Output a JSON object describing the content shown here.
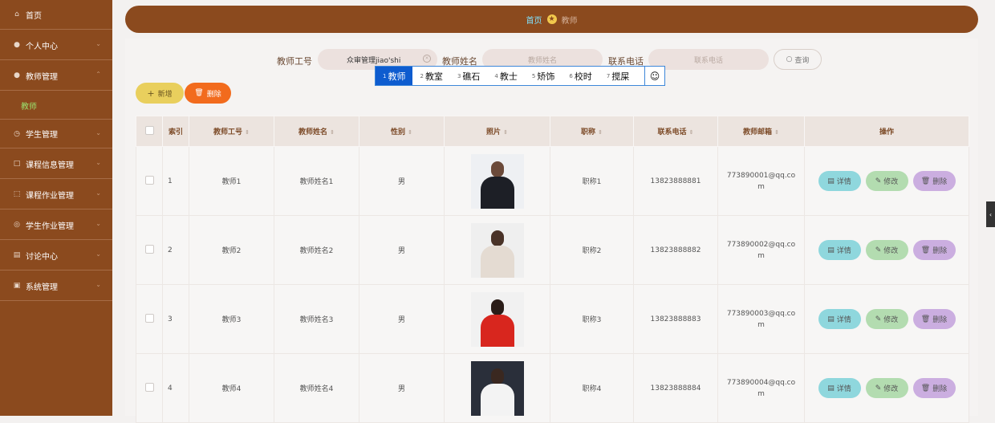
{
  "sidebar": {
    "items": [
      {
        "label": "首页",
        "icon": "home-icon"
      },
      {
        "label": "个人中心",
        "icon": "user-icon"
      },
      {
        "label": "教师管理",
        "icon": "user-icon"
      },
      {
        "label": "学生管理",
        "icon": "clock-icon"
      },
      {
        "label": "课程信息管理",
        "icon": "square-icon"
      },
      {
        "label": "课程作业管理",
        "icon": "dashed-square-icon"
      },
      {
        "label": "学生作业管理",
        "icon": "compass-icon"
      },
      {
        "label": "讨论中心",
        "icon": "chart-icon"
      },
      {
        "label": "系统管理",
        "icon": "briefcase-icon"
      }
    ],
    "sub_item": "教师"
  },
  "breadcrumb": {
    "home": "首页",
    "current": "教师"
  },
  "search": {
    "teacher_id_label": "教师工号",
    "teacher_id_value": "众审管理jiao'shi",
    "teacher_name_label": "教师姓名",
    "teacher_name_placeholder": "教师姓名",
    "phone_label": "联系电话",
    "phone_placeholder": "联系电话",
    "query_button": "查询"
  },
  "ime": {
    "candidates": [
      {
        "n": "1",
        "text": "教师"
      },
      {
        "n": "2",
        "text": "教室"
      },
      {
        "n": "3",
        "text": "礁石"
      },
      {
        "n": "4",
        "text": "教士"
      },
      {
        "n": "5",
        "text": "矫饰"
      },
      {
        "n": "6",
        "text": "校时"
      },
      {
        "n": "7",
        "text": "搅屎"
      }
    ],
    "emoji": "☺"
  },
  "actions": {
    "add": "新增",
    "delete": "删除"
  },
  "table": {
    "headers": [
      "索引",
      "教师工号",
      "教师姓名",
      "性别",
      "照片",
      "职称",
      "联系电话",
      "教师邮箱",
      "操作"
    ],
    "rows": [
      {
        "index": "1",
        "id": "教师1",
        "name": "教师姓名1",
        "gender": "男",
        "title": "职称1",
        "phone": "13823888881",
        "email": "773890001@qq.co",
        "email2": "m"
      },
      {
        "index": "2",
        "id": "教师2",
        "name": "教师姓名2",
        "gender": "男",
        "title": "职称2",
        "phone": "13823888882",
        "email": "773890002@qq.co",
        "email2": "m"
      },
      {
        "index": "3",
        "id": "教师3",
        "name": "教师姓名3",
        "gender": "男",
        "title": "职称3",
        "phone": "13823888883",
        "email": "773890003@qq.co",
        "email2": "m"
      },
      {
        "index": "4",
        "id": "教师4",
        "name": "教师姓名4",
        "gender": "男",
        "title": "职称4",
        "phone": "13823888884",
        "email": "773890004@qq.co",
        "email2": "m"
      }
    ],
    "op_labels": {
      "detail": "详情",
      "edit": "修改",
      "delete": "删除"
    }
  },
  "colors": {
    "brand": "#8b4a1e",
    "ime_selected": "#0e5ccf",
    "add": "#e9cf5d",
    "delete": "#f26b1d"
  }
}
